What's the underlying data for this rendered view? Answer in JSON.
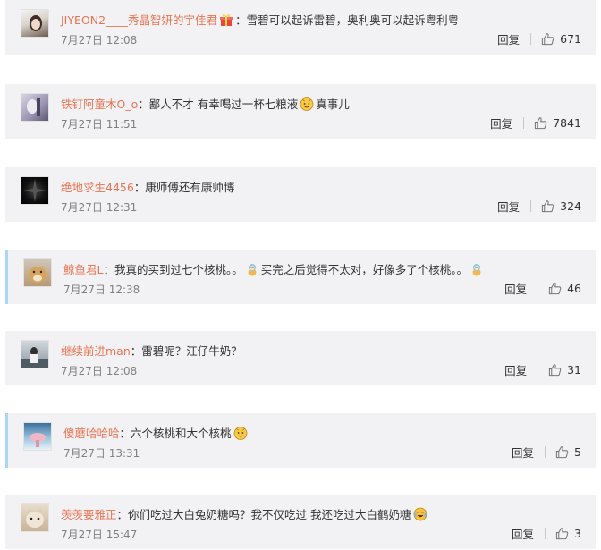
{
  "comments": [
    {
      "username": "JIYEON2____秀晶智妍的宇佳君",
      "text": "雪碧可以起诉雷碧，奥利奥可以起诉粤利粤",
      "time": "7月27日 12:08",
      "reply": "回复",
      "likes": "671"
    },
    {
      "username": "铁钉阿童木O_o",
      "text": "鄙人不才 有幸喝过一杯七粮液",
      "text_after": "真事儿",
      "time": "7月27日 11:51",
      "reply": "回复",
      "likes": "7841"
    },
    {
      "username": "绝地求生4456",
      "text": "康师傅还有康帅博",
      "time": "7月27日 12:31",
      "reply": "回复",
      "likes": "324"
    },
    {
      "username": "鲸鱼君L",
      "text": "我真的买到过七个核桃。。",
      "text_after": "买完之后觉得不太对，好像多了个核桃。。",
      "time": "7月27日 12:38",
      "reply": "回复",
      "likes": "46"
    },
    {
      "username": "继续前进man",
      "text": "雷碧呢？汪仔牛奶？",
      "time": "7月27日 12:08",
      "reply": "回复",
      "likes": "31"
    },
    {
      "username": "傻蘑哈哈哈",
      "text": "六个核桃和大个核桃",
      "time": "7月27日 13:31",
      "reply": "回复",
      "likes": "5"
    },
    {
      "username": "羡羡要雅正",
      "text": "你们吃过大白兔奶糖吗？我不仅吃过 我还吃过大白鹤奶糖",
      "time": "7月27日 15:47",
      "reply": "回复",
      "likes": "3"
    }
  ],
  "colors": {
    "username": "#eb7350",
    "card_bg": "#f2f2f5",
    "accent_border": "#a9d6f5",
    "time": "#808080"
  },
  "icons": {
    "like": "thumbs-up-icon",
    "emoji_face": "smiley-emoji-icon",
    "emoji_laugh": "laugh-cry-emoji-icon",
    "emoji_gift": "gift-emoji-icon",
    "emoji_doll": "doll-emoji-icon"
  }
}
